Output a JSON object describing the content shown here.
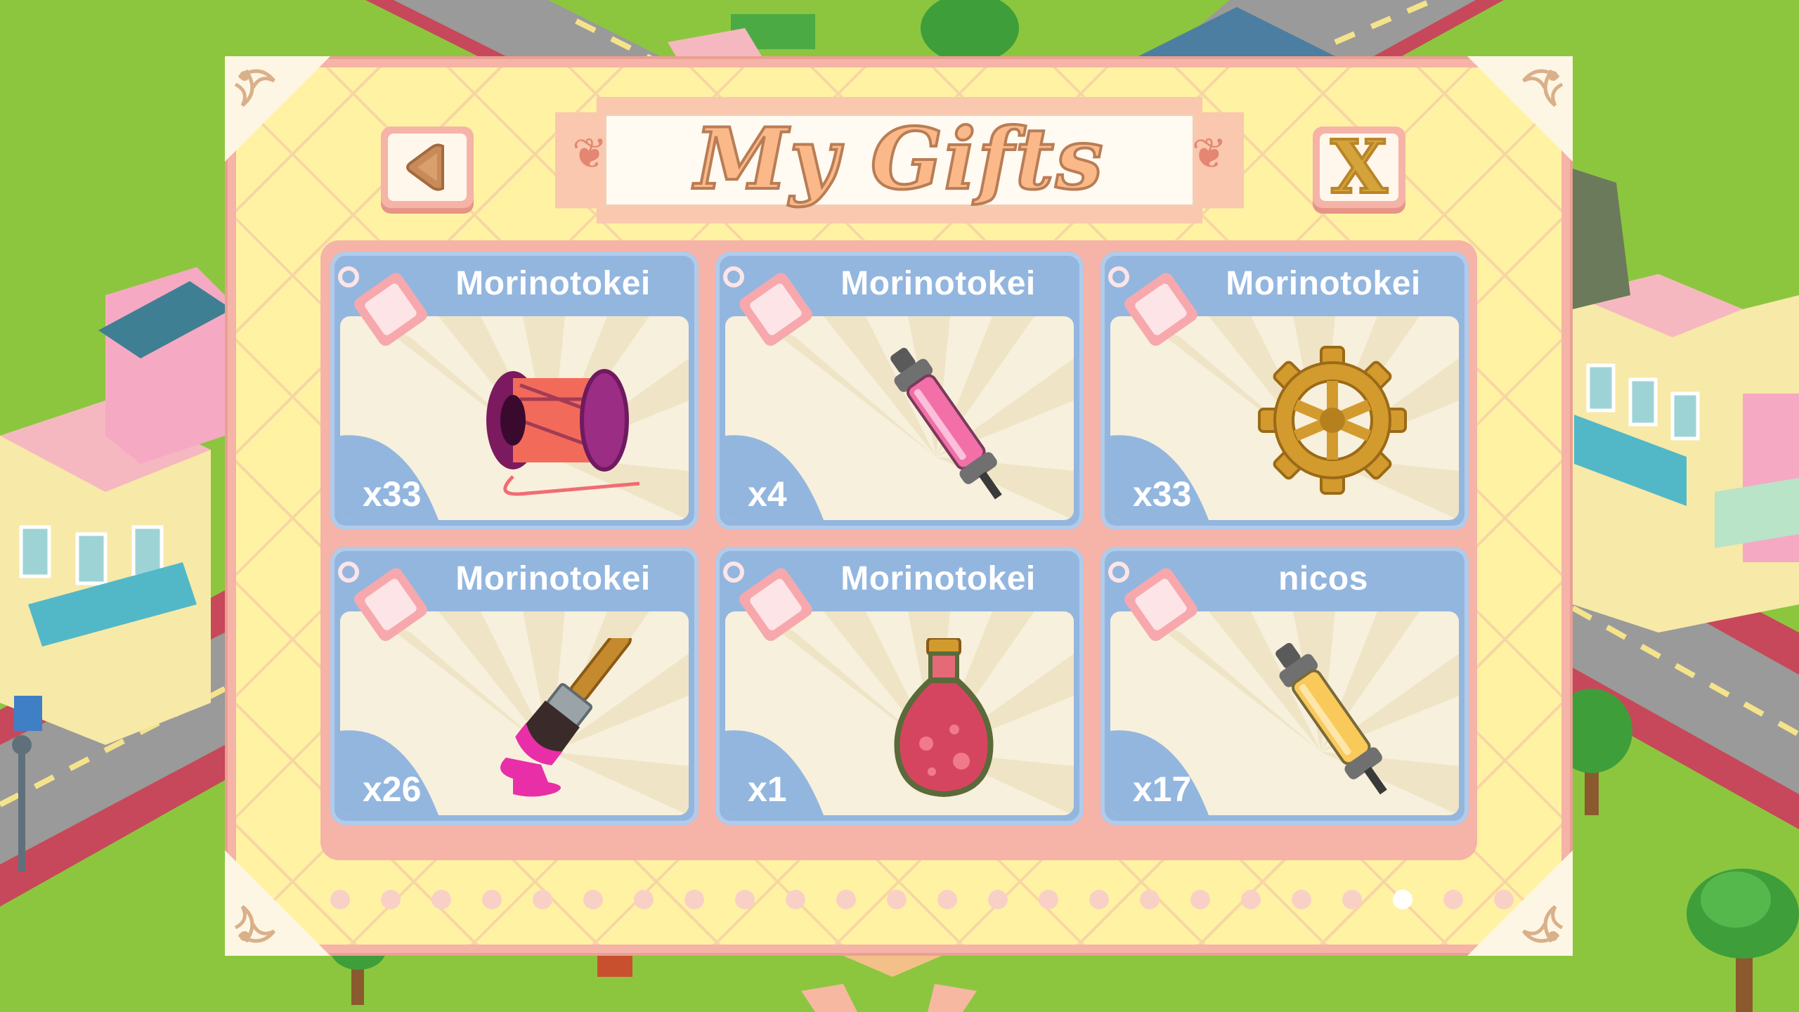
{
  "dialog": {
    "title": "My Gifts",
    "back_button": {
      "icon": "left-triangle-icon"
    },
    "close_button": {
      "label": "X"
    }
  },
  "gifts": [
    {
      "sender": "Morinotokei",
      "count": "x33",
      "item_icon": "thread-spool-icon"
    },
    {
      "sender": "Morinotokei",
      "count": "x4",
      "item_icon": "pink-tube-icon"
    },
    {
      "sender": "Morinotokei",
      "count": "x33",
      "item_icon": "gear-icon"
    },
    {
      "sender": "Morinotokei",
      "count": "x26",
      "item_icon": "paintbrush-icon"
    },
    {
      "sender": "Morinotokei",
      "count": "x1",
      "item_icon": "potion-bottle-icon"
    },
    {
      "sender": "nicos",
      "count": "x17",
      "item_icon": "yellow-tube-icon"
    }
  ],
  "pagination": {
    "total_pages": 24,
    "current_page": 22
  },
  "colors": {
    "grass": "#8cc63f",
    "panel_border": "#f6b3a8",
    "panel_fill": "#fff3a3",
    "card_blue": "#93b6df",
    "title_orange": "#fbb98a"
  }
}
